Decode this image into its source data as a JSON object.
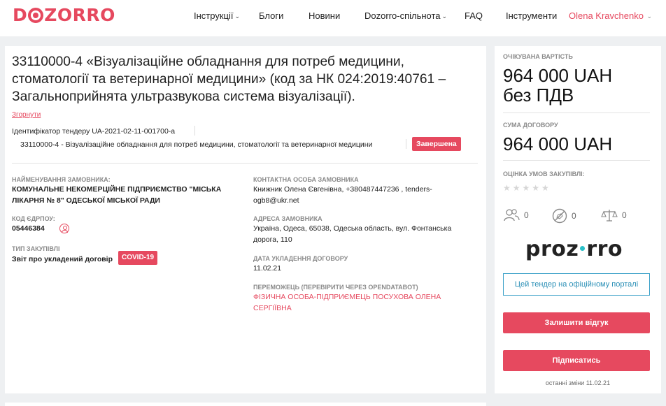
{
  "header": {
    "logo": {
      "left": "D",
      "right": "ZORRO"
    },
    "nav": [
      {
        "label": "Інструкції",
        "dropdown": true
      },
      {
        "label": "Блоги",
        "dropdown": false
      },
      {
        "label": "Новини",
        "dropdown": false
      },
      {
        "label": "Dozorro-спільнота",
        "dropdown": true
      },
      {
        "label": "FAQ",
        "dropdown": false
      },
      {
        "label": "Інструменти",
        "dropdown": false
      }
    ],
    "user": "Olena Kravchenko"
  },
  "tender": {
    "title": "33110000-4 «Візуалізаційне обладнання для потреб медицини, стоматології та ветеринарної медицини» (код за НК 024:2019:40761 – Загальноприйнята ультразвукова система візуалізації).",
    "collapse_label": "Згорнути",
    "id_label": "Ідентифікатор тендеру UA-2021-02-11-001700-a",
    "cpv": "33110000-4 - Візуалізаційне обладнання для потреб медицини, стоматології та ветеринарної медицини",
    "status": "Завершена"
  },
  "details": {
    "customer_name_label": "НАЙМЕНУВАННЯ ЗАМОВНИКА:",
    "customer_name": "КОМУНАЛЬНЕ НЕКОМЕРЦІЙНЕ ПІДПРИЄМСТВО \"МІСЬКА ЛІКАРНЯ № 8\" ОДЕСЬКОЇ МІСЬКОЇ РАДИ",
    "edrpou_label": "КОД ЄДРПОУ:",
    "edrpou": "05446384",
    "procurement_type_label": "ТИП ЗАКУПІВЛІ",
    "procurement_type": "Звіт про укладений договір",
    "covid_badge": "COVID-19",
    "contact_label": "КОНТАКТНА ОСОБА ЗАМОВНИКА",
    "contact": "Книжник Олена Євгенівна, +380487447236 , tenders-ogb8@ukr.net",
    "address_label": "АДРЕСА ЗАМОВНИКА",
    "address": "Україна, Одеса, 65038, Одеська область, вул. Фонтанська дорога, 110",
    "contract_date_label": "ДАТА УКЛАДЕННЯ ДОГОВОРУ",
    "contract_date": "11.02.21",
    "winner_label": "ПЕРЕМОЖЕЦЬ (ПЕРЕВІРИТИ ЧЕРЕЗ OPENDATABOT)",
    "winner": "ФІЗИЧНА ОСОБА-ПІДПРИЄМЕЦЬ ПОСУХОВА ОЛЕНА СЕРГІЇВНА"
  },
  "sidebar": {
    "expected_cost_label": "ОЧІКУВАНА ВАРТІСТЬ",
    "expected_cost": "964 000 UAH",
    "expected_cost_vat": "без ПДВ",
    "contract_sum_label": "СУМА ДОГОВОРУ",
    "contract_sum": "964 000 UAH",
    "rating_label": "ОЦІНКА УМОВ ЗАКУПІВЛІ:",
    "rating_stars": "★★★★★",
    "rating_value": 0,
    "stats": [
      {
        "icon": "users-icon",
        "count": "0"
      },
      {
        "icon": "violation-icon",
        "count": "0"
      },
      {
        "icon": "scales-icon",
        "count": "0"
      }
    ],
    "prozorro_logo": {
      "left": "proz",
      "right": "rro"
    },
    "official_portal_button": "Цей тендер на офіційному порталі",
    "leave_review_button": "Залишити відгук",
    "subscribe_button": "Підписатись",
    "last_change": "останні зміни 11.02.21"
  },
  "colors": {
    "accent": "#e6495f",
    "link": "#2a8fb6",
    "prozorro_dot": "#29c0c8"
  }
}
